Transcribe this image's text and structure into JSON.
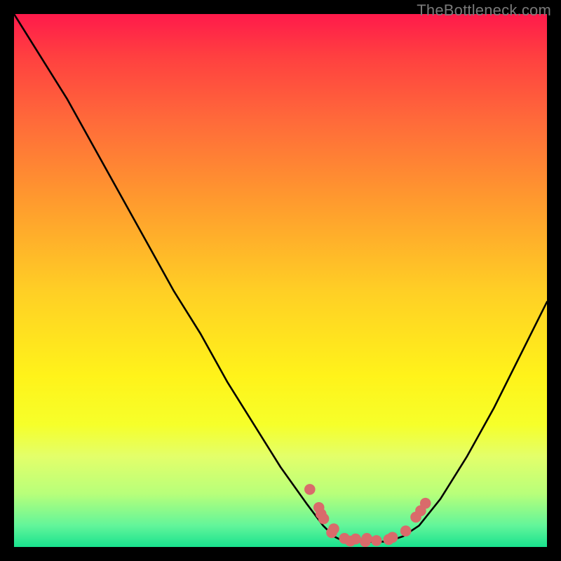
{
  "watermark": "TheBottleneck.com",
  "colors": {
    "background": "#000000",
    "curve": "#000000",
    "dots": "#d96b6b",
    "gradient_top": "#ff1a4b",
    "gradient_bottom": "#19e28e"
  },
  "chart_data": {
    "type": "line",
    "title": "",
    "xlabel": "",
    "ylabel": "",
    "curve": {
      "comment": "V-shaped bottleneck curve. x in [0,100], y in [0,100] where 0 is bottom (green) and 100 is top (red). Approximate samples read from pixels; valley floor clamps at ~1.",
      "x": [
        0,
        5,
        10,
        15,
        20,
        25,
        30,
        35,
        40,
        45,
        50,
        55,
        58,
        60,
        62,
        65,
        68,
        70,
        73,
        76,
        80,
        85,
        90,
        95,
        100
      ],
      "y": [
        100,
        92,
        84,
        75,
        66,
        57,
        48,
        40,
        31,
        23,
        15,
        8,
        4,
        2,
        1,
        1,
        1,
        1,
        2,
        4,
        9,
        17,
        26,
        36,
        46
      ]
    },
    "markers": {
      "comment": "Salmon scatter points near the valley — left descending cluster, flat bottom cluster, right ascending cluster. Same x/y scale as curve.",
      "x": [
        55.5,
        57.2,
        57.6,
        58.1,
        59.6,
        60.0,
        62.0,
        63.1,
        64.1,
        65.9,
        66.2,
        68.0,
        70.3,
        71.0,
        73.5,
        75.4,
        76.3,
        77.2
      ],
      "y": [
        10.8,
        7.4,
        6.2,
        5.3,
        2.7,
        3.4,
        1.6,
        1.1,
        1.5,
        1.0,
        1.6,
        1.2,
        1.4,
        1.8,
        3.0,
        5.6,
        6.8,
        8.2
      ]
    },
    "xlim": [
      0,
      100
    ],
    "ylim": [
      0,
      100
    ]
  }
}
